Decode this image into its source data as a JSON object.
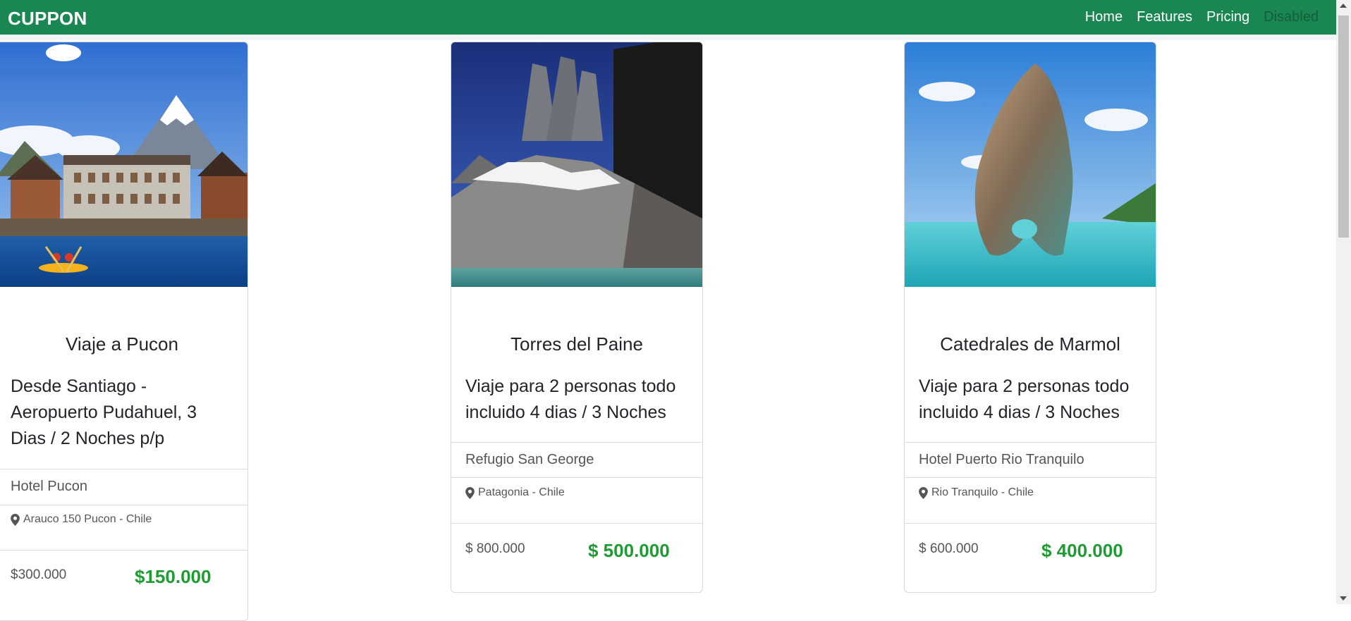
{
  "navbar": {
    "brand": "CUPPON",
    "links": [
      {
        "label": "Home"
      },
      {
        "label": "Features"
      },
      {
        "label": "Pricing"
      },
      {
        "label": "Disabled"
      }
    ]
  },
  "cards": [
    {
      "title": "Viaje a Pucon",
      "subtitle": "Desde Santiago - Aeropuerto Pudahuel, 3 Dias / 2 Noches p/p",
      "hotel": "Hotel Pucon",
      "location": "Arauco 150 Pucon - Chile",
      "old_price": "$300.000",
      "new_price": "$150.000"
    },
    {
      "title": "Torres del Paine",
      "subtitle": "Viaje para 2 personas todo incluido 4 dias / 3 Noches",
      "hotel": "Refugio San George",
      "location": "Patagonia - Chile",
      "old_price": "$ 800.000",
      "new_price": "$ 500.000"
    },
    {
      "title": "Catedrales de Marmol",
      "subtitle": "Viaje para 2 personas todo incluido 4 dias / 3 Noches",
      "hotel": "Hotel Puerto Rio Tranquilo",
      "location": "Rio Tranquilo - Chile",
      "old_price": "$ 600.000",
      "new_price": "$ 400.000"
    }
  ],
  "colors": {
    "navbar_bg": "#1a8753",
    "price_green": "#1f9b34"
  }
}
